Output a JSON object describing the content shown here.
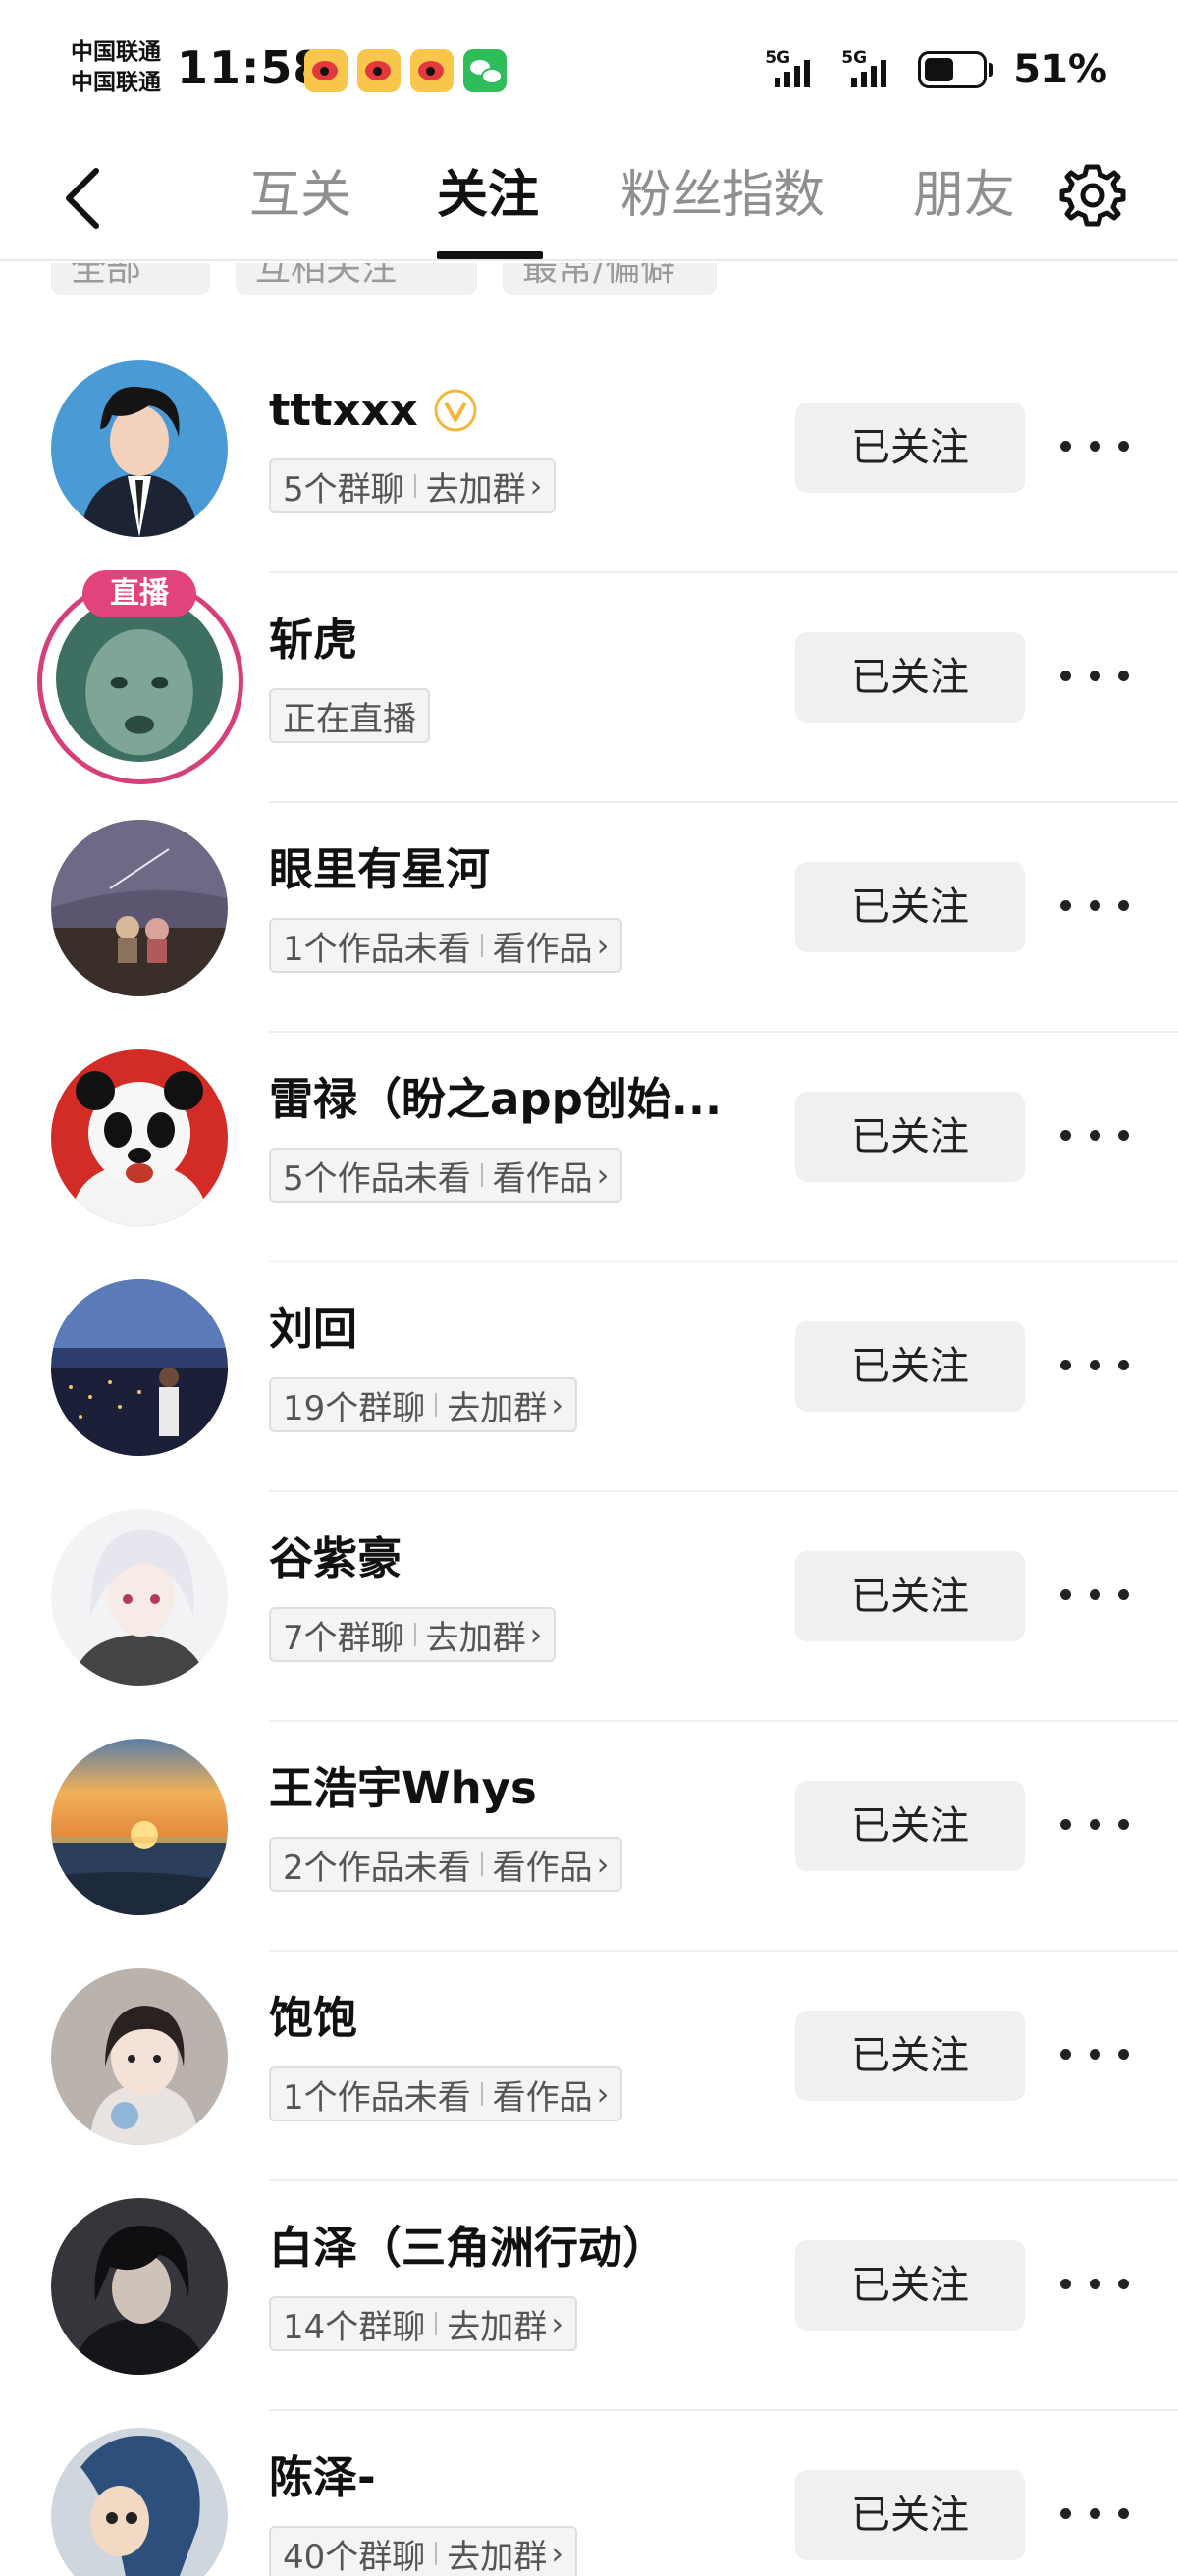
{
  "status_bar": {
    "carrier_1": "中国联通",
    "carrier_2": "中国联通",
    "time": "11:58",
    "network_1": "5G",
    "network_2": "5G",
    "battery_percent": 51,
    "battery_text": "51%",
    "notification_icons": [
      "weibo-icon",
      "weibo-icon",
      "weibo-icon",
      "wechat-icon"
    ]
  },
  "header": {
    "tabs": [
      {
        "label": "互关",
        "active": false
      },
      {
        "label": "关注",
        "active": true
      },
      {
        "label": "粉丝指数",
        "active": false
      },
      {
        "label": "朋友",
        "active": false
      }
    ],
    "back_icon": "chevron-left-icon",
    "settings_icon": "gear-icon"
  },
  "filters": [
    "全部",
    "互相关注",
    "最常/偏僻"
  ],
  "follow_button_label": "已关注",
  "follows": [
    {
      "name": "tttxxx",
      "verified": true,
      "tag_left": "5个群聊",
      "tag_right": "去加群",
      "live": false
    },
    {
      "name": "斩虎",
      "verified": false,
      "tag_left": "正在直播",
      "tag_right": "",
      "live": true,
      "live_badge": "直播"
    },
    {
      "name": "眼里有星河",
      "verified": false,
      "tag_left": "1个作品未看",
      "tag_right": "看作品",
      "live": false
    },
    {
      "name": "雷禄（盼之app创始...",
      "verified": false,
      "tag_left": "5个作品未看",
      "tag_right": "看作品",
      "live": false
    },
    {
      "name": "刘回",
      "verified": false,
      "tag_left": "19个群聊",
      "tag_right": "去加群",
      "live": false
    },
    {
      "name": "谷紫豪",
      "verified": false,
      "tag_left": "7个群聊",
      "tag_right": "去加群",
      "live": false
    },
    {
      "name": "王浩宇Whys",
      "verified": false,
      "tag_left": "2个作品未看",
      "tag_right": "看作品",
      "live": false
    },
    {
      "name": "饱饱",
      "verified": false,
      "tag_left": "1个作品未看",
      "tag_right": "看作品",
      "live": false
    },
    {
      "name": "白泽（三角洲行动）",
      "verified": false,
      "tag_left": "14个群聊",
      "tag_right": "去加群",
      "live": false
    },
    {
      "name": "陈泽-",
      "verified": false,
      "tag_left": "40个群聊",
      "tag_right": "去加群",
      "live": false
    }
  ]
}
